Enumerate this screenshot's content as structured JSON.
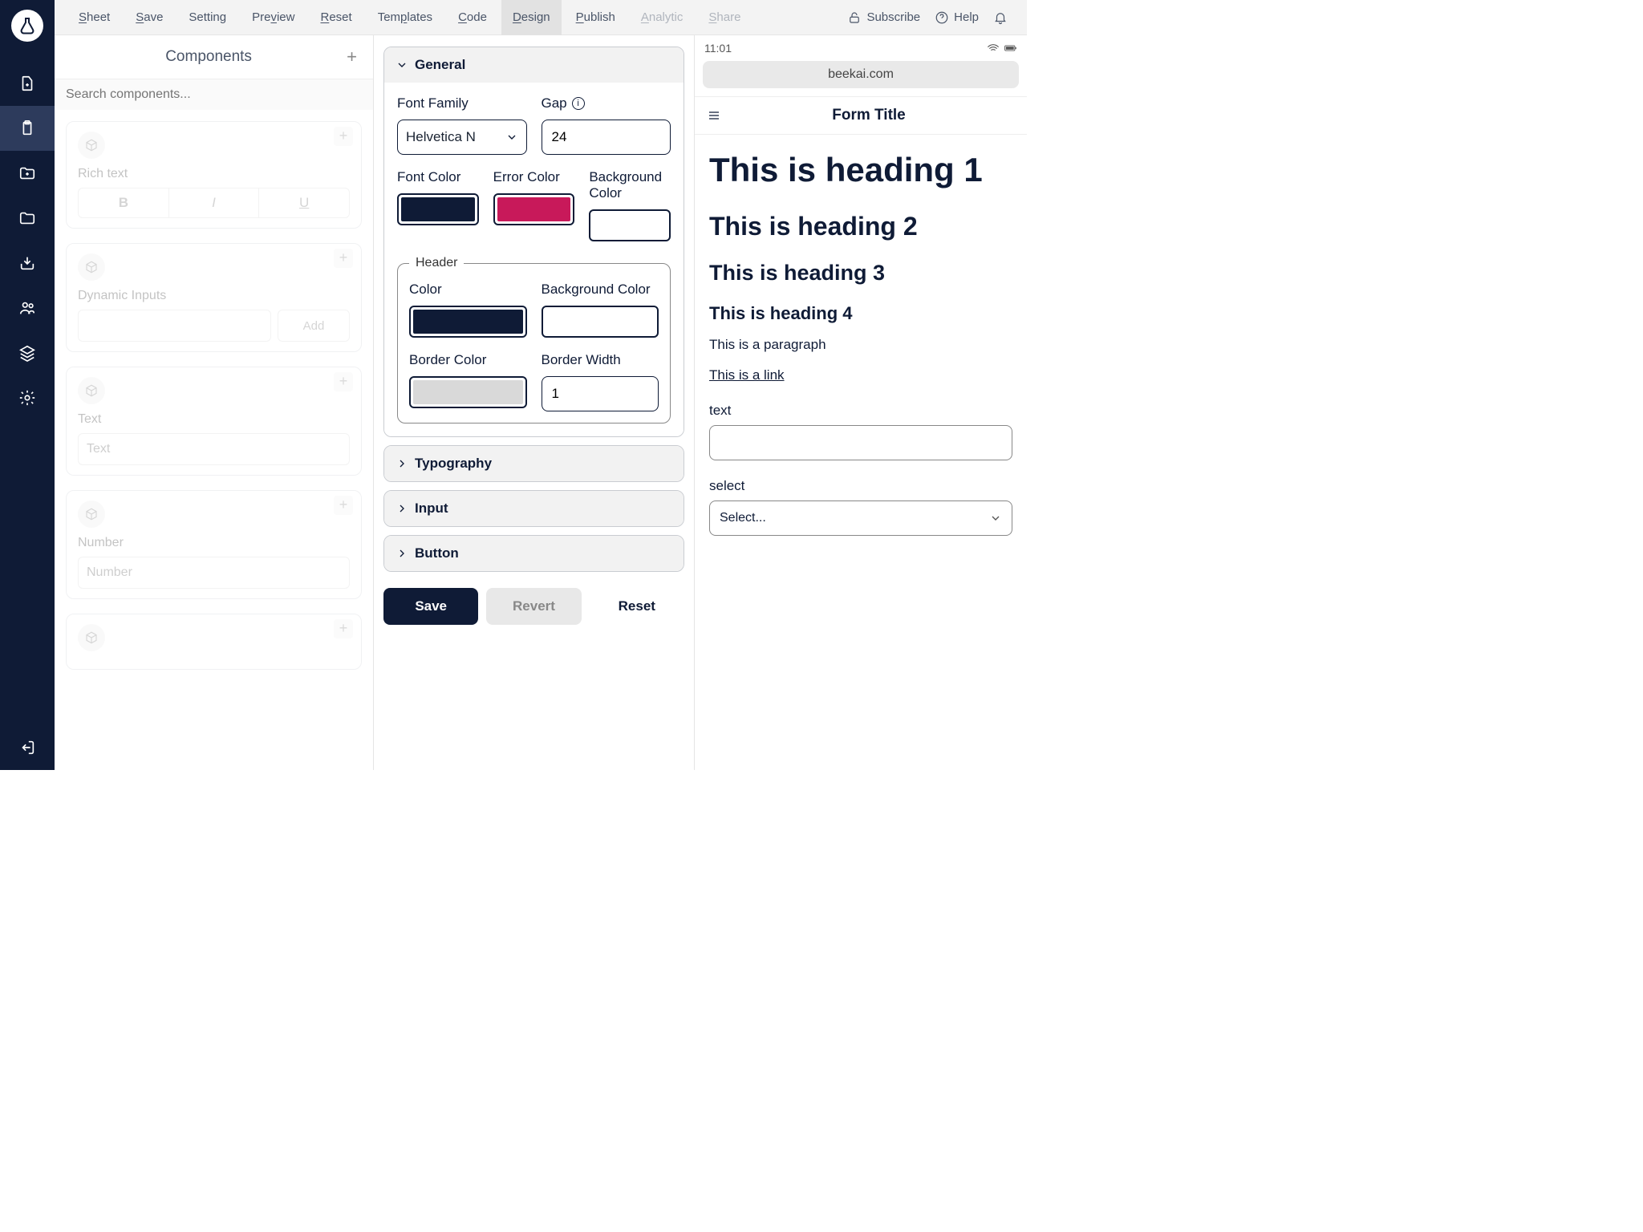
{
  "toolbar": {
    "items": [
      {
        "label": "Sheet",
        "u": 1,
        "rest": "heet"
      },
      {
        "label": "Save",
        "u": 1,
        "rest": "ave"
      },
      {
        "label": "Setting"
      },
      {
        "label": "Preview",
        "u": 3,
        "pre": "Pre",
        "mid": "v",
        "rest": "iew"
      },
      {
        "label": "Reset",
        "u": 1,
        "rest": "eset"
      },
      {
        "label": "Templates",
        "u": 3,
        "pre": "Tem",
        "mid": "p",
        "rest": "lates"
      },
      {
        "label": "Code",
        "u": 1,
        "rest": "ode"
      },
      {
        "label": "Design",
        "u": 1,
        "rest": "esign",
        "active": true
      },
      {
        "label": "Publish",
        "u": 1,
        "rest": "ublish"
      },
      {
        "label": "Analytic",
        "u": 1,
        "rest": "nalytic",
        "disabled": true
      },
      {
        "label": "Share",
        "u": 1,
        "rest": "hare",
        "disabled": true
      }
    ],
    "subscribe": "Subscribe",
    "help": "Help"
  },
  "components": {
    "title": "Components",
    "search_placeholder": "Search components...",
    "cards": {
      "rich_text": "Rich text",
      "dynamic_inputs": "Dynamic Inputs",
      "add": "Add",
      "text": "Text",
      "text_placeholder": "Text",
      "number": "Number",
      "number_placeholder": "Number",
      "bold": "B",
      "italic": "I",
      "underline": "U"
    }
  },
  "design": {
    "sections": {
      "general": "General",
      "typography": "Typography",
      "input": "Input",
      "button": "Button"
    },
    "general": {
      "font_family_label": "Font Family",
      "font_family_value": "Helvetica N",
      "gap_label": "Gap",
      "gap_value": "24",
      "font_color_label": "Font Color",
      "error_color_label": "Error Color",
      "background_color_label": "Background Color",
      "font_color": "#0f1b36",
      "error_color": "#c8195a",
      "background_color": "#ffffff",
      "header_legend": "Header",
      "header_color_label": "Color",
      "header_bg_label": "Background Color",
      "header_color": "#0f1b36",
      "header_bg": "#ffffff",
      "border_color_label": "Border Color",
      "border_width_label": "Border Width",
      "border_color": "#d9d9d9",
      "border_width": "1"
    },
    "actions": {
      "save": "Save",
      "revert": "Revert",
      "reset": "Reset"
    }
  },
  "preview": {
    "time": "11:01",
    "url": "beekai.com",
    "form_title": "Form Title",
    "h1": "This is heading 1",
    "h2": "This is heading 2",
    "h3": "This is heading 3",
    "h4": "This is heading 4",
    "paragraph": "This is a paragraph",
    "link": "This is a link",
    "text_label": "text",
    "select_label": "select",
    "select_placeholder": "Select..."
  }
}
